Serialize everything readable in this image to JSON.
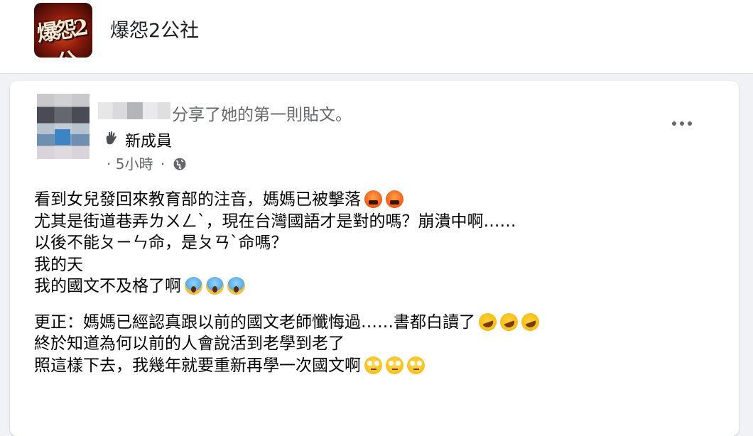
{
  "group": {
    "name": "爆怨2公社",
    "avatar_text": "爆怨2公"
  },
  "post": {
    "author_action": "分享了她的第一則貼文。",
    "badge": "新成員",
    "time": "5小時",
    "separator": "·",
    "icons": {
      "badge": "waving-hand-icon",
      "privacy": "globe-icon",
      "more": "more-options-icon"
    },
    "lines_1": [
      "看到女兒發回來教育部的注音，媽媽已被擊落",
      "尤其是街道巷弄ㄌㄨㄥˋ，現在台灣國語才是對的嗎？崩潰中啊……",
      "以後不能ㄆㄧㄣ命，是ㄆㄢˋ命嗎？",
      "我的天",
      "我的國文不及格了啊"
    ],
    "lines_2": [
      "更正：媽媽已經認真跟以前的國文老師懺悔過……書都白讀了",
      "終於知道為何以前的人會說活到老學到老了",
      "照這樣下去，我幾年就要重新再學一次國文啊"
    ]
  }
}
